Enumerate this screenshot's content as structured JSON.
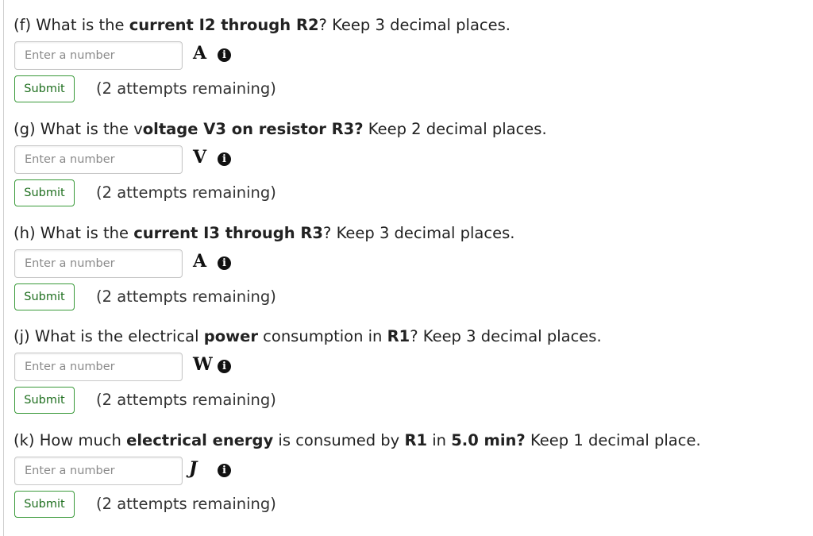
{
  "questions": [
    {
      "prefix": "(f) What is the ",
      "bold1": "current I2 through R2",
      "mid": "? Keep 3 decimal places.",
      "bold2": "",
      "mid2": "",
      "bold3": "",
      "suffix": "",
      "placeholder": "Enter a number",
      "unit": "A",
      "info_icon": "info-icon",
      "submit_label": "Submit",
      "attempts": "(2 attempts remaining)"
    },
    {
      "prefix": "(g) What is the v",
      "bold1": "oltage V3 on resistor R3?",
      "mid": " Keep 2 decimal places.",
      "bold2": "",
      "mid2": "",
      "bold3": "",
      "suffix": "",
      "placeholder": "Enter a number",
      "unit": "V",
      "info_icon": "info-icon",
      "submit_label": "Submit",
      "attempts": "(2 attempts remaining)"
    },
    {
      "prefix": "(h) What is the ",
      "bold1": "current I3 through R3",
      "mid": "? Keep 3 decimal places.",
      "bold2": "",
      "mid2": "",
      "bold3": "",
      "suffix": "",
      "placeholder": "Enter a number",
      "unit": "A",
      "info_icon": "info-icon",
      "submit_label": "Submit",
      "attempts": "(2 attempts remaining)"
    },
    {
      "prefix": "(j) What is the electrical ",
      "bold1": "power",
      "mid": " consumption in ",
      "bold2": "R1",
      "mid2": "?  Keep 3 decimal places.",
      "bold3": "",
      "suffix": "",
      "placeholder": "Enter a number",
      "unit": "W",
      "info_icon": "info-icon",
      "submit_label": "Submit",
      "attempts": "(2 attempts remaining)"
    },
    {
      "prefix": "(k) How much ",
      "bold1": "electrical energy",
      "mid": " is consumed by ",
      "bold2": "R1",
      "mid2": " in ",
      "bold3": "5.0 min?",
      "suffix": " Keep 1 decimal place.",
      "placeholder": "Enter a number",
      "unit": "J",
      "info_icon": "info-icon",
      "submit_label": "Submit",
      "attempts": "(2 attempts remaining)"
    }
  ],
  "colors": {
    "submit_border": "#3a9a3a",
    "submit_text": "#1f6f1f",
    "input_border": "#c8c8c8",
    "placeholder_text": "#8a8a8a"
  }
}
